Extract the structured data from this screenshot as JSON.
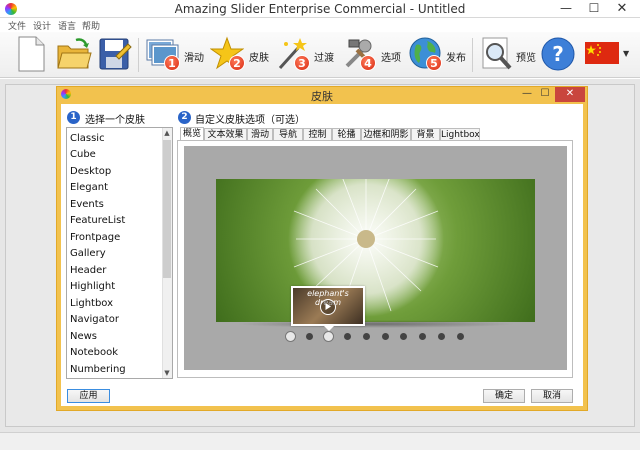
{
  "window": {
    "title": "Amazing Slider Enterprise Commercial - Untitled"
  },
  "menu": [
    "文件",
    "设计",
    "语言",
    "帮助"
  ],
  "toolbar": {
    "buttons": [
      {
        "label": "滑动",
        "step": "1"
      },
      {
        "label": "皮肤",
        "step": "2"
      },
      {
        "label": "过渡",
        "step": "3"
      },
      {
        "label": "选项",
        "step": "4"
      },
      {
        "label": "发布",
        "step": "5"
      }
    ],
    "preview_label": "预览"
  },
  "dialog": {
    "title": "皮肤",
    "step1": {
      "num": "1",
      "label": "选择一个皮肤"
    },
    "step2": {
      "num": "2",
      "label": "自定义皮肤选项（可选）"
    },
    "skins": [
      "Classic",
      "Cube",
      "Desktop",
      "Elegant",
      "Events",
      "FeatureList",
      "Frontpage",
      "Gallery",
      "Header",
      "Highlight",
      "Lightbox",
      "Navigator",
      "News",
      "Notebook",
      "Numbering"
    ],
    "tabs": [
      "概览",
      "文本效果",
      "滑动",
      "导航",
      "控制",
      "轮播",
      "边框和阴影",
      "背景",
      "Lightbox"
    ],
    "active_tab": "概览",
    "preview": {
      "thumb_caption": "elephant's dream",
      "dot_count": 10,
      "active_dot": 2
    },
    "apply_label": "应用",
    "ok_label": "确定",
    "cancel_label": "取消"
  },
  "colors": {
    "dialog_border": "#f2c24e",
    "step_badge": "#2a64c8",
    "toolbar_badge": "#d82a12"
  }
}
